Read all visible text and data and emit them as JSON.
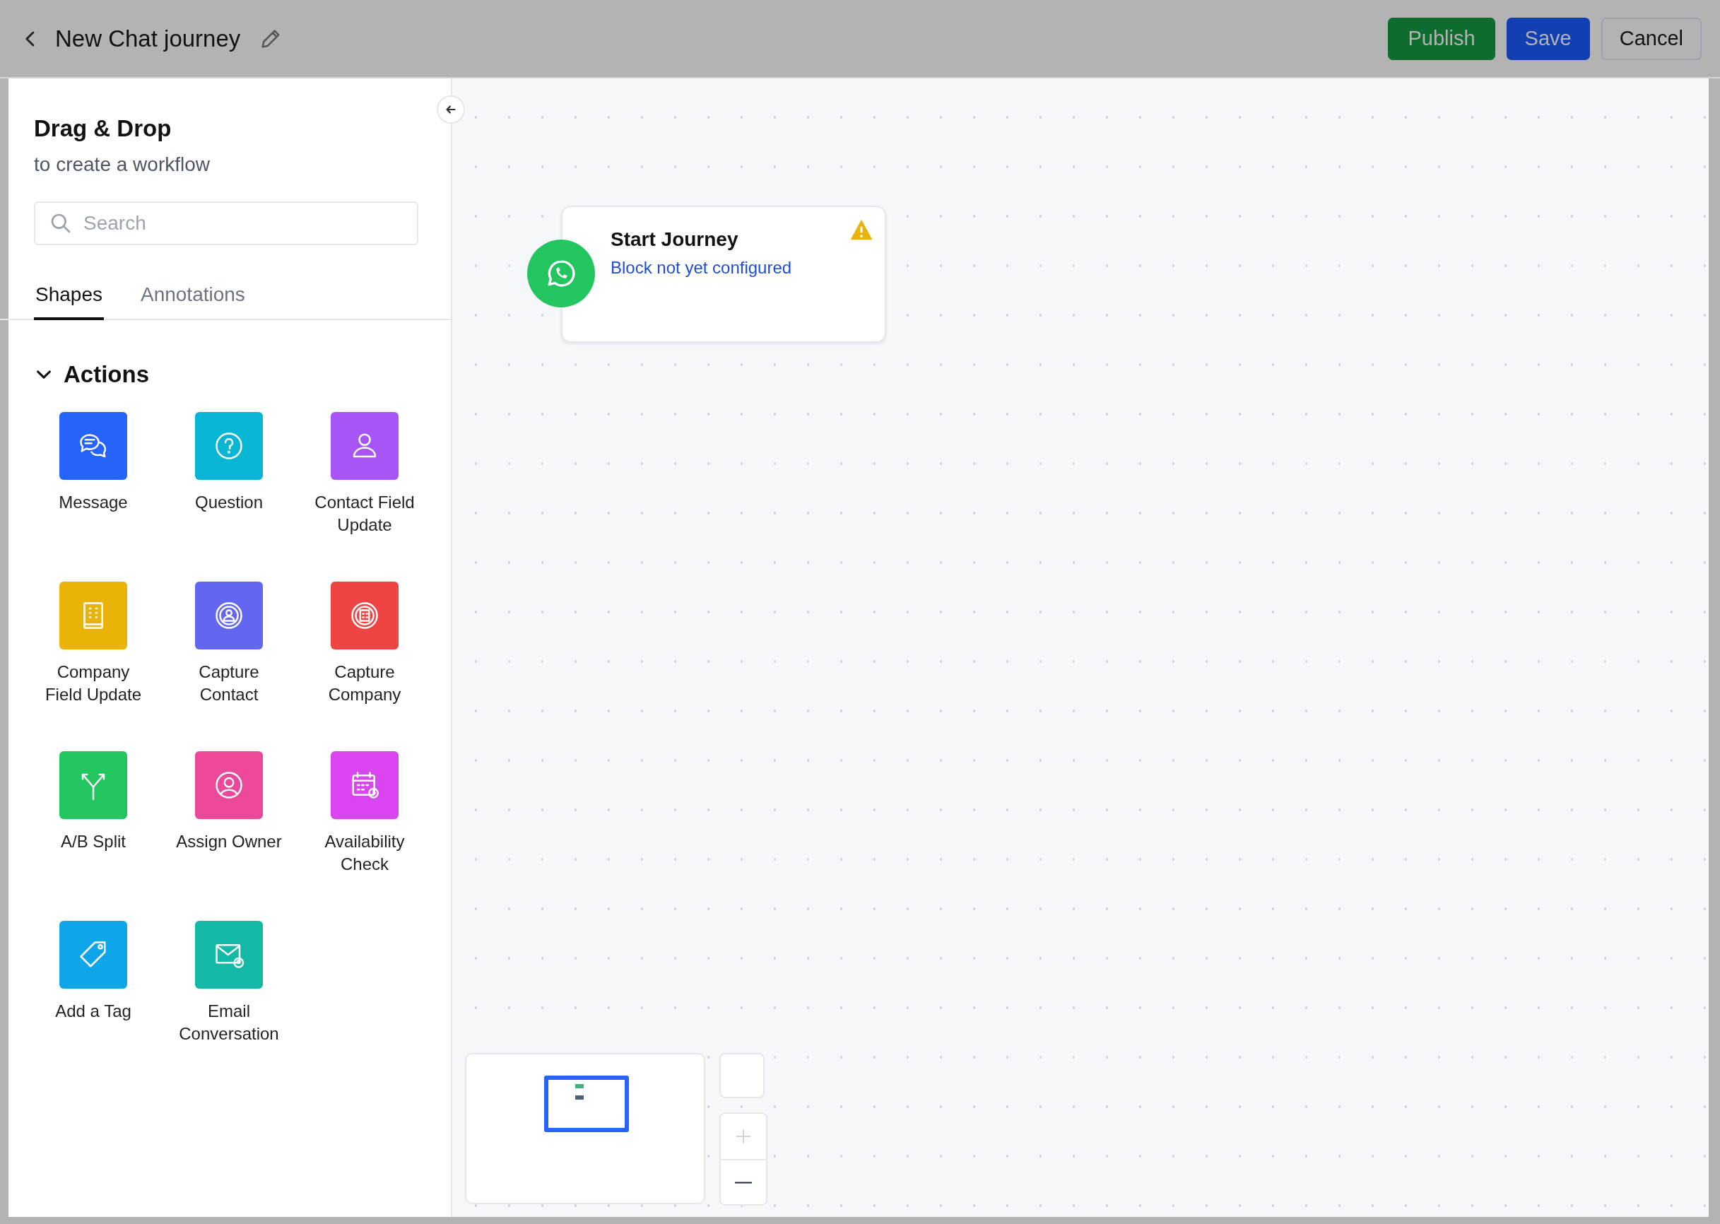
{
  "header": {
    "title": "New Chat journey",
    "buttons": [
      {
        "label": "Publish",
        "kind": "publish"
      },
      {
        "label": "Save",
        "kind": "save"
      },
      {
        "label": "Cancel",
        "kind": "cancel"
      }
    ]
  },
  "sidebar": {
    "heading": "Drag & Drop",
    "subheading": "to create a workflow",
    "search": {
      "placeholder": "Search"
    },
    "tabs": [
      {
        "label": "Shapes",
        "selected": true
      },
      {
        "label": "Annotations",
        "selected": false
      }
    ],
    "section": {
      "title": "Actions",
      "expanded": true,
      "items": [
        {
          "label": "Message",
          "kind": "message",
          "color": "#2563fb"
        },
        {
          "label": "Question",
          "kind": "question",
          "color": "#06b6d4"
        },
        {
          "label": "Contact Field Update",
          "kind": "contact",
          "color": "#a855f7"
        },
        {
          "label": "Company Field Update",
          "kind": "company",
          "color": "#eab308"
        },
        {
          "label": "Capture Contact",
          "kind": "capture-contact",
          "color": "#6366f1"
        },
        {
          "label": "Capture Company",
          "kind": "capture-company",
          "color": "#ef4444"
        },
        {
          "label": "A/B Split",
          "kind": "split",
          "color": "#22c55e"
        },
        {
          "label": "Assign Owner",
          "kind": "owner",
          "color": "#ec4899"
        },
        {
          "label": "Availability Check",
          "kind": "calendar",
          "color": "#d946ef"
        },
        {
          "label": "Add a Tag",
          "kind": "tag",
          "color": "#0ea5e9"
        },
        {
          "label": "Email Conversation",
          "kind": "email",
          "color": "#14b8a6"
        }
      ]
    }
  },
  "canvas": {
    "node": {
      "title": "Start Journey",
      "status": "Block not yet configured",
      "warning": true
    }
  }
}
